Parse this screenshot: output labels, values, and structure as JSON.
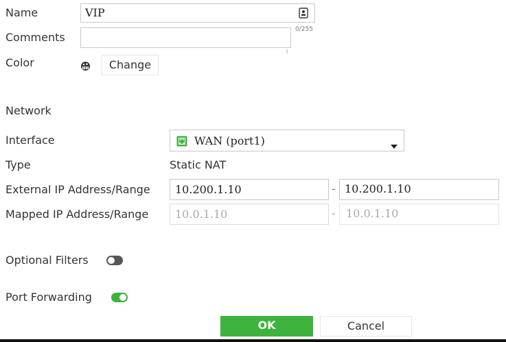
{
  "form": {
    "name_label": "Name",
    "name_value": "VIP",
    "comments_label": "Comments",
    "comments_counter": "0/255",
    "color_label": "Color",
    "color_change_label": "Change"
  },
  "network": {
    "section_title": "Network",
    "interface_label": "Interface",
    "interface_value": "WAN (port1)",
    "type_label": "Type",
    "type_value": "Static NAT",
    "external_label": "External IP Address/Range",
    "external_start": "10.200.1.10",
    "external_end": "10.200.1.10",
    "mapped_label": "Mapped IP Address/Range",
    "mapped_start": "10.0.1.10",
    "mapped_end": "10.0.1.10",
    "range_separator": "-"
  },
  "options": {
    "optional_filters_label": "Optional Filters",
    "optional_filters_on": false,
    "port_forwarding_label": "Port Forwarding",
    "port_forwarding_on": true
  },
  "buttons": {
    "ok_label": "OK",
    "cancel_label": "Cancel"
  },
  "colors": {
    "accent_green": "#3db33d",
    "toggle_off": "#555555"
  },
  "icons": {
    "name_field_icon": "id-card-icon",
    "color_icon": "palette-icon",
    "interface_icon": "network-port-icon",
    "dropdown_icon": "caret-down-icon"
  }
}
